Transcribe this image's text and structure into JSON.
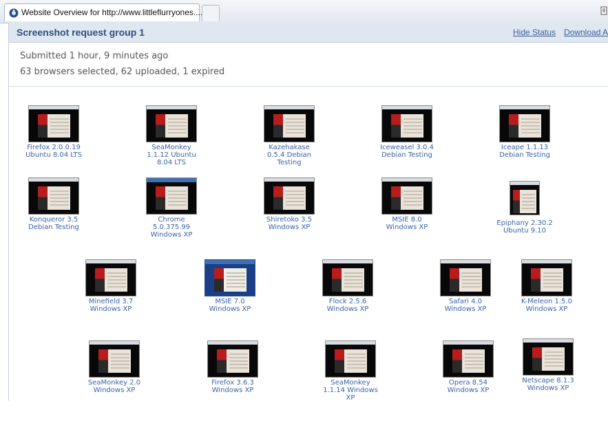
{
  "browser": {
    "tab_title": "Website Overview for http://www.littleflurryones....",
    "favicon": "site-favicon-icon"
  },
  "group": {
    "title": "Screenshot request group 1",
    "hide_status": "Hide Status",
    "download": "Download Al"
  },
  "status": {
    "submitted": "Submitted 1 hour, 9 minutes ago",
    "counts": "63 browsers selected, 62 uploaded, 1 expired"
  },
  "screenshots": [
    {
      "line1": "Firefox 2.0.0.19",
      "line2": "Ubuntu 8.04 LTS",
      "line3": ""
    },
    {
      "line1": "SeaMonkey",
      "line2": "1.1.12 Ubuntu",
      "line3": "8.04 LTS"
    },
    {
      "line1": "Kazehakase",
      "line2": "0.5.4 Debian",
      "line3": "Testing"
    },
    {
      "line1": "Iceweasel 3.0.4",
      "line2": "Debian Testing",
      "line3": ""
    },
    {
      "line1": "Iceape 1.1.13",
      "line2": "Debian Testing",
      "line3": ""
    },
    {
      "line1": "Konqueror 3.5",
      "line2": "Debian Testing",
      "line3": ""
    },
    {
      "line1": "Chrome",
      "line2": "5.0.375.99",
      "line3": "Windows XP"
    },
    {
      "line1": "Shiretoko 3.5",
      "line2": "Windows XP",
      "line3": ""
    },
    {
      "line1": "MSIE 8.0",
      "line2": "Windows XP",
      "line3": ""
    },
    {
      "line1": "Epiphany 2.30.2",
      "line2": "Ubuntu 9.10",
      "line3": ""
    },
    {
      "line1": "Minefield 3.7",
      "line2": "Windows XP",
      "line3": ""
    },
    {
      "line1": "MSIE 7.0",
      "line2": "Windows XP",
      "line3": ""
    },
    {
      "line1": "Flock 2.5.6",
      "line2": "Windows XP",
      "line3": ""
    },
    {
      "line1": "Safari 4.0",
      "line2": "Windows XP",
      "line3": ""
    },
    {
      "line1": "K-Meleon 1.5.0",
      "line2": "Windows XP",
      "line3": ""
    },
    {
      "line1": "SeaMonkey 2.0",
      "line2": "Windows XP",
      "line3": ""
    },
    {
      "line1": "Firefox 3.6.3",
      "line2": "Windows XP",
      "line3": ""
    },
    {
      "line1": "SeaMonkey",
      "line2": "1.1.14 Windows",
      "line3": "XP"
    },
    {
      "line1": "Opera 8.54",
      "line2": "Windows XP",
      "line3": ""
    },
    {
      "line1": "Netscape 8.1.3",
      "line2": "Windows XP",
      "line3": ""
    }
  ]
}
